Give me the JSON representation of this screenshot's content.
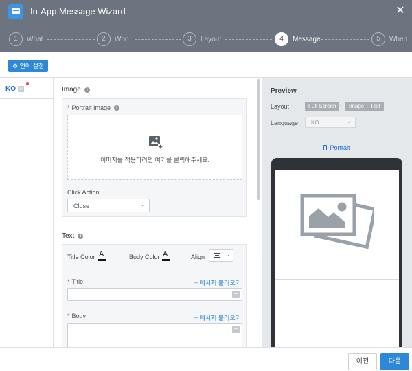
{
  "window": {
    "title": "In-App Message Wizard",
    "close": "✕"
  },
  "steps": [
    {
      "num": "1",
      "label": "What"
    },
    {
      "num": "2",
      "label": "Who"
    },
    {
      "num": "3",
      "label": "Layout"
    },
    {
      "num": "4",
      "label": "Message"
    },
    {
      "num": "5",
      "label": "When"
    }
  ],
  "active_step": 4,
  "toolbar": {
    "lang_settings": "⚙ 언어 설정"
  },
  "languages": {
    "selected": "KO",
    "default_badge": "D"
  },
  "form": {
    "image_section": "Image",
    "portrait_image_label": "Portrait Image",
    "dropzone_text": "이미지를 적용하려면 여기를 클릭해주세요.",
    "click_action_label": "Click Action",
    "click_action_value": "Close",
    "text_section": "Text",
    "title_color_label": "Title Color",
    "body_color_label": "Body Color",
    "align_label": "Align",
    "title_label": "Title",
    "title_value": "",
    "body_label": "Body",
    "body_value": "",
    "load_message_link": "+ 메시지 불러오기",
    "plus": "+",
    "info": "i",
    "required": "*",
    "color_glyph": "A",
    "chevron": "⌄"
  },
  "preview": {
    "title": "Preview",
    "layout_label": "Layout",
    "layout_chip1": "Full Screen",
    "layout_chip2": "Image + Text",
    "layout_sep": "›",
    "language_label": "Language",
    "language_value": "KO",
    "orientation_tab": "Portrait"
  },
  "footer": {
    "prev": "이전",
    "next": "다음"
  },
  "colors": {
    "header": "#6c757f",
    "accent": "#2e88d8",
    "preview_bg": "#e5e8eb"
  }
}
